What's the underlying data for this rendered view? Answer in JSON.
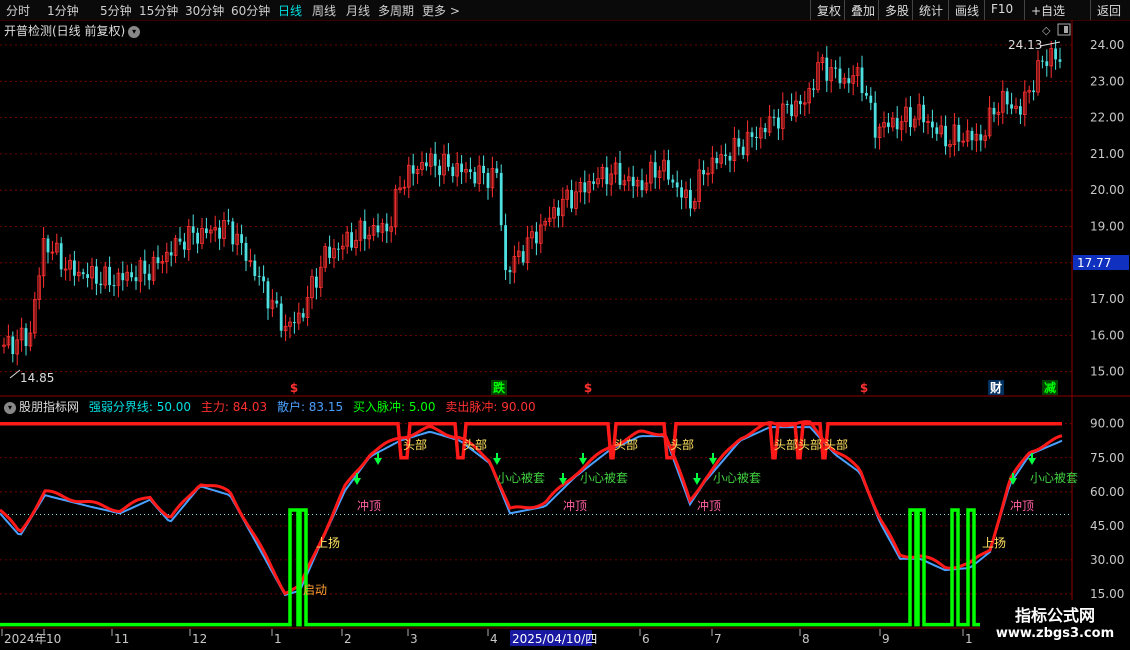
{
  "toolbar": {
    "left_items": [
      "分时",
      "1分钟",
      "5分钟",
      "15分钟",
      "30分钟",
      "60分钟",
      "日线",
      "周线",
      "月线",
      "多周期",
      "更多 >"
    ],
    "active_item": "日线",
    "right_items": [
      "复权",
      "叠加",
      "多股",
      "统计",
      "画线",
      "F10",
      "+自选",
      "返回"
    ]
  },
  "main_chart": {
    "title": "开普检测(日线 前复权)",
    "price_labels": [
      "24.00",
      "23.00",
      "22.00",
      "21.00",
      "20.00",
      "19.00",
      "18.00",
      "17.00",
      "16.00",
      "15.00"
    ],
    "current_price": "17.77",
    "high_marker": "24.13",
    "low_marker": "14.85",
    "event_markers": [
      {
        "text": "$",
        "color": "#ff3030"
      },
      {
        "text": "跌",
        "color": "#00ff00",
        "bg": "#004400"
      },
      {
        "text": "$",
        "color": "#ff3030"
      },
      {
        "text": "$",
        "color": "#ff3030"
      },
      {
        "text": "财",
        "color": "#ffffff",
        "bg": "#003060"
      },
      {
        "text": "减",
        "color": "#00ff00",
        "bg": "#004400"
      }
    ]
  },
  "indicator": {
    "name": "股朋指标网",
    "fields": [
      {
        "label": "强弱分界线: 50.00",
        "color": "#00e0e0"
      },
      {
        "label": "主力: 84.03",
        "color": "#ff3030"
      },
      {
        "label": "散户: 83.15",
        "color": "#4aa0ff"
      },
      {
        "label": "买入脉冲: 5.00",
        "color": "#00ff00"
      },
      {
        "label": "卖出脉冲: 90.00",
        "color": "#ff3030"
      }
    ],
    "y_labels": [
      "90.00",
      "75.00",
      "60.00",
      "45.00",
      "30.00",
      "15.00"
    ],
    "annotations": {
      "top": "头部",
      "careful": "小心被套",
      "surge": "冲顶",
      "rise": "上扬",
      "start": "启动"
    }
  },
  "x_axis": {
    "labels": [
      "2024年",
      "10",
      "11",
      "12",
      "1",
      "2",
      "3",
      "4",
      "2025/04/10/四",
      "6",
      "7",
      "8",
      "9",
      "1"
    ]
  },
  "watermark": {
    "line1": "指标公式网",
    "line2": "www.zbgs3.com"
  },
  "colors": {
    "up": "#ff3030",
    "down": "#4ee0e0",
    "main_line": "#ff1a1a",
    "retail_line": "#4aa0ff",
    "buy_pulse": "#00ff00",
    "sell_pulse": "#ff1a1a",
    "grid": "#8b0000"
  }
}
